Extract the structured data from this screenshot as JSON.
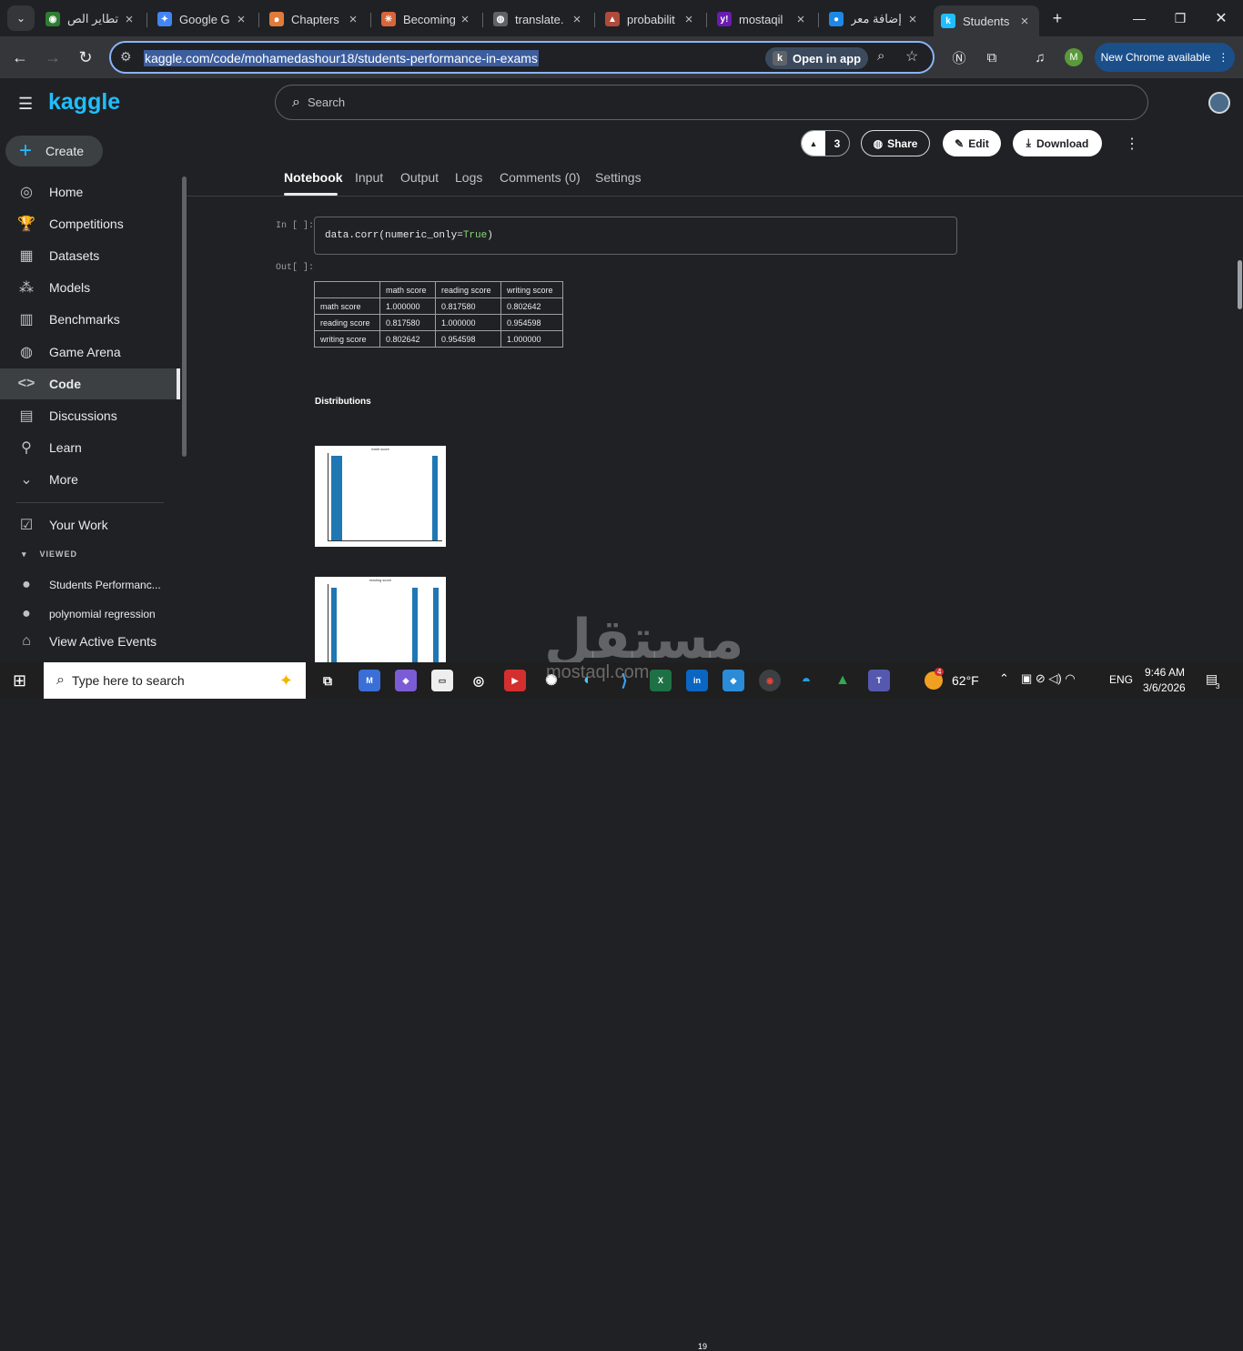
{
  "tabs": [
    {
      "title": "تطاير الص",
      "color": "#2e7d32",
      "glyph": "◉"
    },
    {
      "title": "Google G",
      "color": "#4285f4",
      "glyph": "✦"
    },
    {
      "title": "Chapters",
      "color": "#e07b39",
      "glyph": "๑"
    },
    {
      "title": "Becoming",
      "color": "#d9653b",
      "glyph": "✳"
    },
    {
      "title": "translate.",
      "color": "#5f6368",
      "glyph": "◍"
    },
    {
      "title": "probabilit",
      "color": "#b04a3a",
      "glyph": "▲"
    },
    {
      "title": "mostaqil",
      "color": "#6a1bb0",
      "glyph": "y!"
    },
    {
      "title": "إضافة معر",
      "color": "#1e88e5",
      "glyph": "●"
    },
    {
      "title": "Students",
      "color": "#20beff",
      "glyph": "k"
    }
  ],
  "browser": {
    "url": "kaggle.com/code/mohamedashour18/students-performance-in-exams",
    "open_in_app": "Open in app",
    "new_chrome": "New Chrome available",
    "profile_initial": "M"
  },
  "kaggle": {
    "logo": "kaggle",
    "create": "Create",
    "nav": [
      "Home",
      "Competitions",
      "Datasets",
      "Models",
      "Benchmarks",
      "Game Arena",
      "Code",
      "Discussions",
      "Learn",
      "More"
    ],
    "your_work": "Your Work",
    "viewed": "VIEWED",
    "viewed_items": [
      "Students Performanc...",
      "polynomial regression"
    ],
    "active_events": "View Active Events",
    "search_placeholder": "Search",
    "vote_count": "3",
    "share": "Share",
    "edit": "Edit",
    "download": "Download",
    "tabs": [
      "Notebook",
      "Input",
      "Output",
      "Logs",
      "Comments (0)",
      "Settings"
    ]
  },
  "notebook": {
    "in_prompt": "In [ ]:",
    "out_prompt": "Out[ ]:",
    "code_prefix": "data.corr(numeric_only=",
    "code_kw": "True",
    "code_suffix": ")",
    "table": {
      "headers": [
        "",
        "math score",
        "reading score",
        "writing score"
      ],
      "rows": [
        [
          "math score",
          "1.000000",
          "0.817580",
          "0.802642"
        ],
        [
          "reading score",
          "0.817580",
          "1.000000",
          "0.954598"
        ],
        [
          "writing score",
          "0.802642",
          "0.954598",
          "1.000000"
        ]
      ]
    },
    "section_title": "Distributions",
    "plot1_title": "math score",
    "plot2_title": "reading score"
  },
  "taskbar": {
    "search": "Type here to search",
    "weather": "62°F",
    "lang": "ENG",
    "time": "9:46 AM",
    "date": "3/6/2026",
    "notif_count": "3",
    "weather_badge": "4",
    "teams_badge": "19"
  },
  "watermark": {
    "text": "مستقل",
    "sub": "mostaql.com"
  }
}
